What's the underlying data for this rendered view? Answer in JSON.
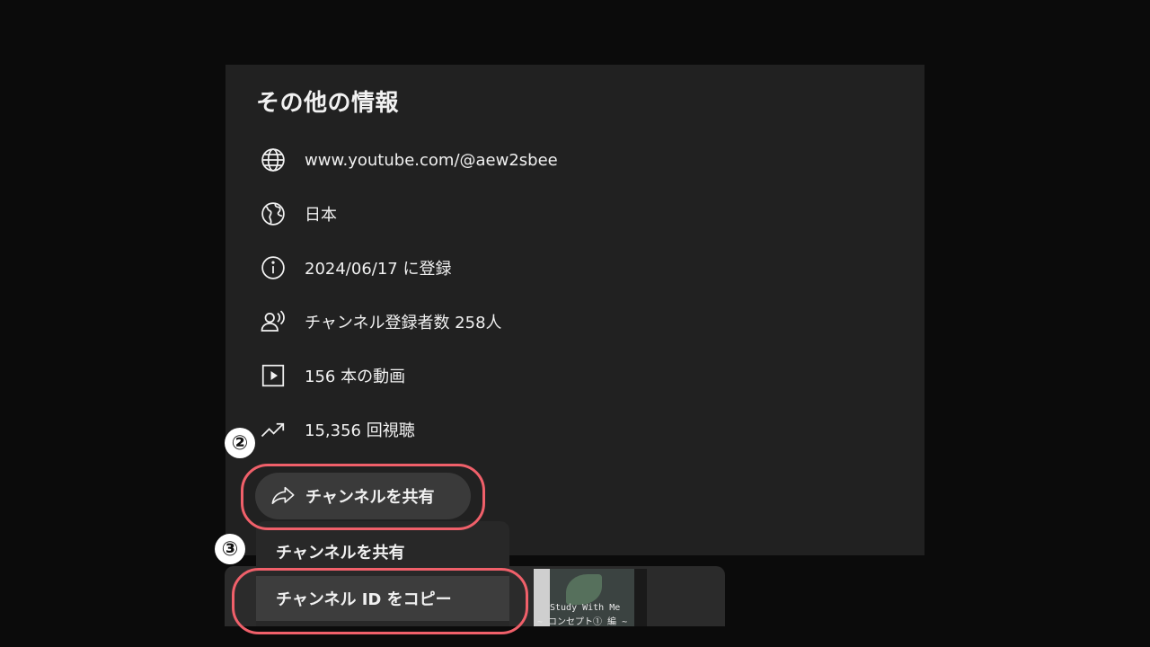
{
  "dialog": {
    "title": "その他の情報",
    "rows": [
      {
        "icon": "globe-icon",
        "text": "www.youtube.com/@aew2sbee"
      },
      {
        "icon": "earth-icon",
        "text": "日本"
      },
      {
        "icon": "info-icon",
        "text": "2024/06/17 に登録"
      },
      {
        "icon": "subscribers-icon",
        "text": "チャンネル登録者数 258人"
      },
      {
        "icon": "video-icon",
        "text": "156 本の動画"
      },
      {
        "icon": "trending-icon",
        "text": "15,356 回視聴"
      }
    ],
    "share_button_label": "チャンネルを共有"
  },
  "menu": {
    "items": [
      {
        "label": "チャンネルを共有"
      },
      {
        "label": "チャンネル ID をコピー"
      }
    ]
  },
  "badges": {
    "step2": "②",
    "step3": "③"
  },
  "thumbnail": {
    "line1": "Study With Me",
    "line2": "~ コンセプト① 編 ~"
  },
  "colors": {
    "page_bg": "#0b0b0b",
    "panel_bg": "#212121",
    "highlight": "#f0606a",
    "text": "#f1f1f1"
  }
}
